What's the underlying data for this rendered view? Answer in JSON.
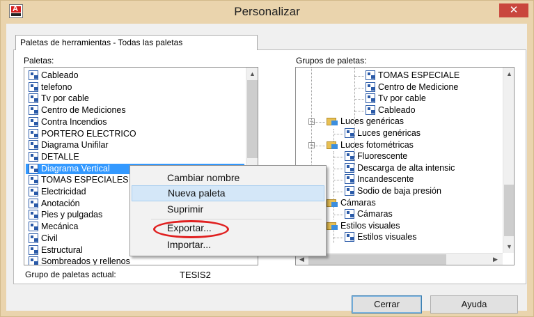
{
  "window": {
    "title": "Personalizar",
    "close_glyph": "✕"
  },
  "tab": {
    "label": "Paletas de herramientas - Todas las paletas"
  },
  "left": {
    "label": "Paletas:",
    "items": [
      "Cableado",
      "telefono",
      "Tv por cable",
      "Centro de Mediciones",
      "Contra Incendios",
      "PORTERO ELECTRICO",
      "Diagrama Unifilar",
      "DETALLE",
      "Diagrama Vertical",
      "TOMAS ESPECIALES",
      "Electricidad",
      "Anotación",
      "Pies y pulgadas",
      "Mecánica",
      "Civil",
      "Estructural",
      "Sombreados y rellenos"
    ],
    "selected_index": 8
  },
  "right": {
    "label": "Grupos de paletas:",
    "items": [
      "TOMAS ESPECIALE",
      "Centro de Medicione",
      "Tv por cable",
      "Cableado",
      "Luces genéricas",
      "Luces genéricas",
      "Luces fotométricas",
      "Fluorescente",
      "Descarga de alta intensic",
      "Incandescente",
      "Sodio de baja presión",
      "Cámaras",
      "Cámaras",
      "Estilos visuales",
      "Estilos visuales"
    ]
  },
  "context_menu": {
    "items": [
      "Cambiar nombre",
      "Nueva paleta",
      "Suprimir",
      "Exportar...",
      "Importar..."
    ],
    "hover_index": 1,
    "circled_index": 3
  },
  "current_group": {
    "label": "Grupo de paletas actual:",
    "value": "TESIS2"
  },
  "buttons": {
    "close": "Cerrar",
    "help": "Ayuda"
  },
  "icons": {
    "palette": "palette-icon",
    "folder": "folder-icon",
    "expand": "minus-expander-icon",
    "app": "autocad-app-icon"
  },
  "colors": {
    "selection": "#3399ff",
    "title_bg": "#ead4ad",
    "close": "#c9463d",
    "highlight_ring": "#e02020"
  }
}
